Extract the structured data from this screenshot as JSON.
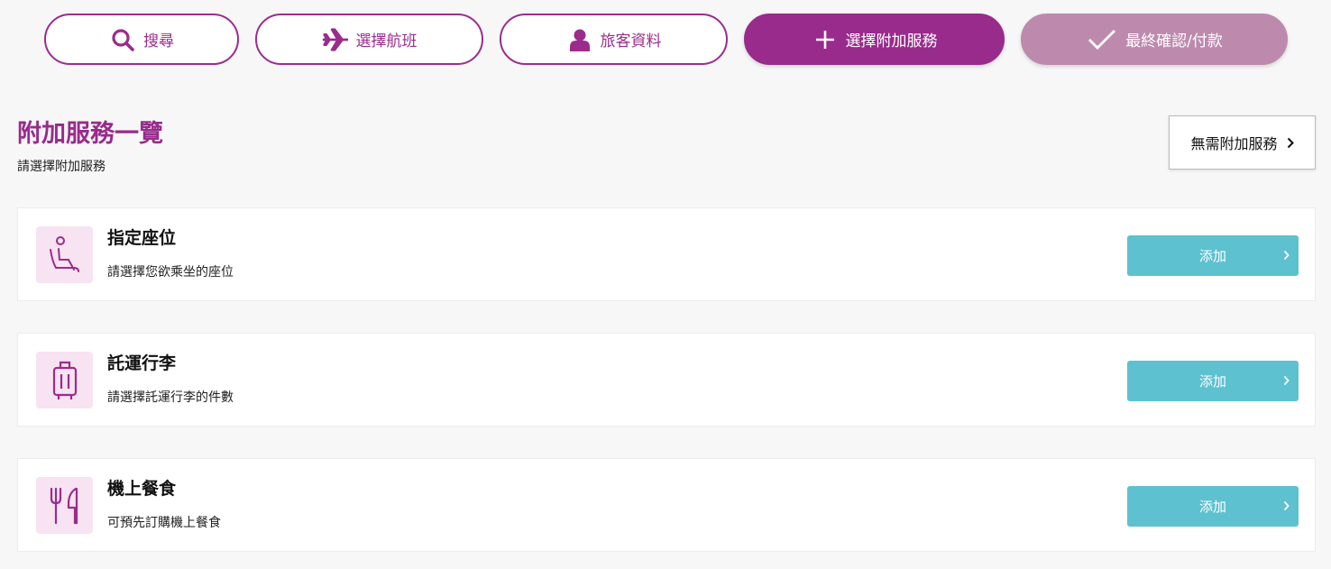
{
  "steps": [
    {
      "label": "搜尋",
      "icon": "search-icon",
      "state": "completed"
    },
    {
      "label": "選擇航班",
      "icon": "airplane-icon",
      "state": "completed"
    },
    {
      "label": "旅客資料",
      "icon": "passenger-icon",
      "state": "completed"
    },
    {
      "label": "選擇附加服務",
      "icon": "plus-icon",
      "state": "current"
    },
    {
      "label": "最終確認/付款",
      "icon": "check-icon",
      "state": "upcoming"
    }
  ],
  "page": {
    "title": "附加服務一覽",
    "subtitle": "請選擇附加服務",
    "skip_label": "無需附加服務"
  },
  "services": [
    {
      "title": "指定座位",
      "desc": "請選擇您欲乘坐的座位",
      "icon": "seat-icon",
      "button": "添加"
    },
    {
      "title": "託運行李",
      "desc": "請選擇託運行李的件數",
      "icon": "luggage-icon",
      "button": "添加"
    },
    {
      "title": "機上餐食",
      "desc": "可預先訂購機上餐食",
      "icon": "meal-icon",
      "button": "添加"
    }
  ],
  "colors": {
    "brand": "#982b8b",
    "brand_light": "#bd8aae",
    "icon_bg": "#f7e3f1",
    "button": "#5ec1d0"
  }
}
